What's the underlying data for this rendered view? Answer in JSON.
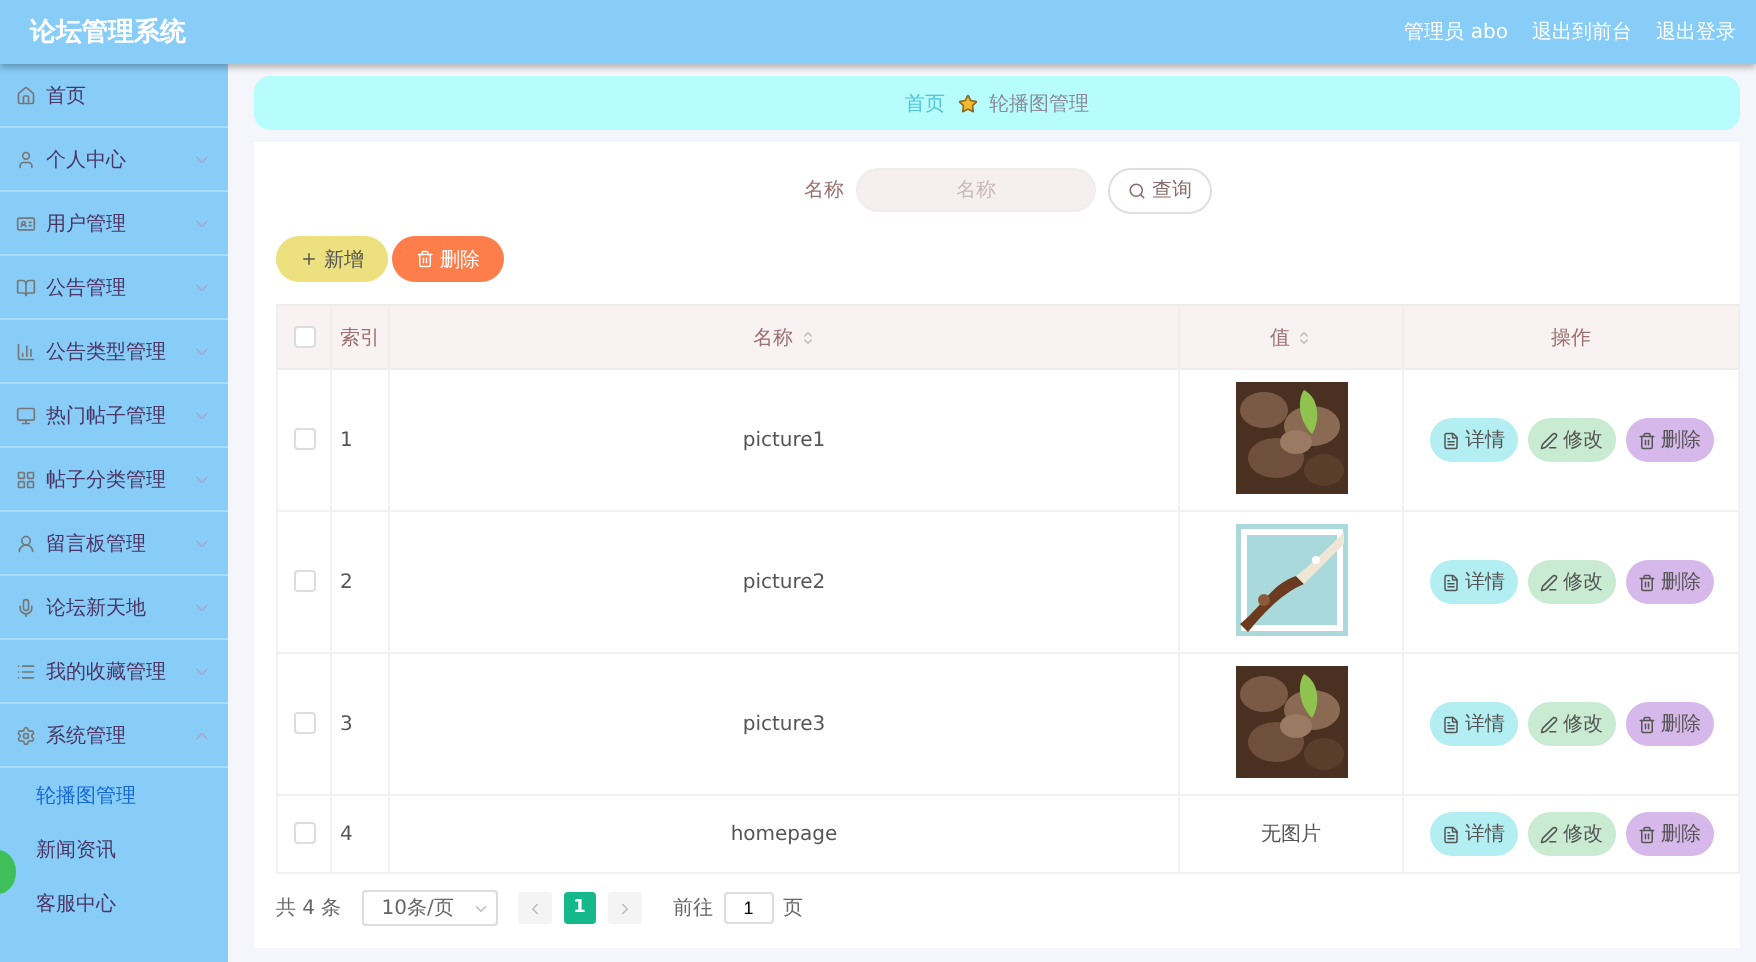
{
  "header": {
    "title": "论坛管理系统",
    "links": [
      "管理员 abo",
      "退出到前台",
      "退出登录"
    ]
  },
  "sidebar": {
    "items": [
      {
        "label": "首页",
        "expandable": false
      },
      {
        "label": "个人中心",
        "expandable": true,
        "expanded": false
      },
      {
        "label": "用户管理",
        "expandable": true,
        "expanded": false
      },
      {
        "label": "公告管理",
        "expandable": true,
        "expanded": false
      },
      {
        "label": "公告类型管理",
        "expandable": true,
        "expanded": false
      },
      {
        "label": "热门帖子管理",
        "expandable": true,
        "expanded": false
      },
      {
        "label": "帖子分类管理",
        "expandable": true,
        "expanded": false
      },
      {
        "label": "留言板管理",
        "expandable": true,
        "expanded": false
      },
      {
        "label": "论坛新天地",
        "expandable": true,
        "expanded": false
      },
      {
        "label": "我的收藏管理",
        "expandable": true,
        "expanded": false
      },
      {
        "label": "系统管理",
        "expandable": true,
        "expanded": true,
        "children": [
          {
            "label": "轮播图管理",
            "selected": true
          },
          {
            "label": "新闻资讯",
            "selected": false
          },
          {
            "label": "客服中心",
            "selected": false
          }
        ]
      }
    ]
  },
  "breadcrumb": [
    "首页",
    "轮播图管理"
  ],
  "search": {
    "label": "名称",
    "placeholder": "名称",
    "button": "查询"
  },
  "actions": [
    "新增",
    "删除"
  ],
  "table": {
    "header_checked": false,
    "columns": [
      {
        "label": "索引",
        "sortable": false
      },
      {
        "label": "名称",
        "sortable": true
      },
      {
        "label": "值",
        "sortable": true
      },
      {
        "label": "操作",
        "sortable": false
      }
    ],
    "rows": [
      {
        "checked": false,
        "index": "1",
        "name": "picture1",
        "value": {
          "kind": "picture"
        },
        "buttons": [
          "详情",
          "修改",
          "删除"
        ]
      },
      {
        "checked": false,
        "index": "2",
        "name": "picture2",
        "value": {
          "kind": "picture"
        },
        "buttons": [
          "详情",
          "修改",
          "删除"
        ]
      },
      {
        "checked": false,
        "index": "3",
        "name": "picture3",
        "value": {
          "kind": "picture"
        },
        "buttons": [
          "详情",
          "修改",
          "删除"
        ]
      },
      {
        "checked": false,
        "index": "4",
        "name": "homepage",
        "value": {
          "kind": "text",
          "text": "无图片"
        },
        "buttons": [
          "详情",
          "修改",
          "删除"
        ]
      }
    ]
  },
  "pagination": {
    "total": "共 4 条",
    "page_size": "10条/页",
    "pages": [
      {
        "label": "1",
        "selected": true
      }
    ],
    "goto": "前往",
    "goto_value": "1",
    "page_suffix": "页"
  }
}
